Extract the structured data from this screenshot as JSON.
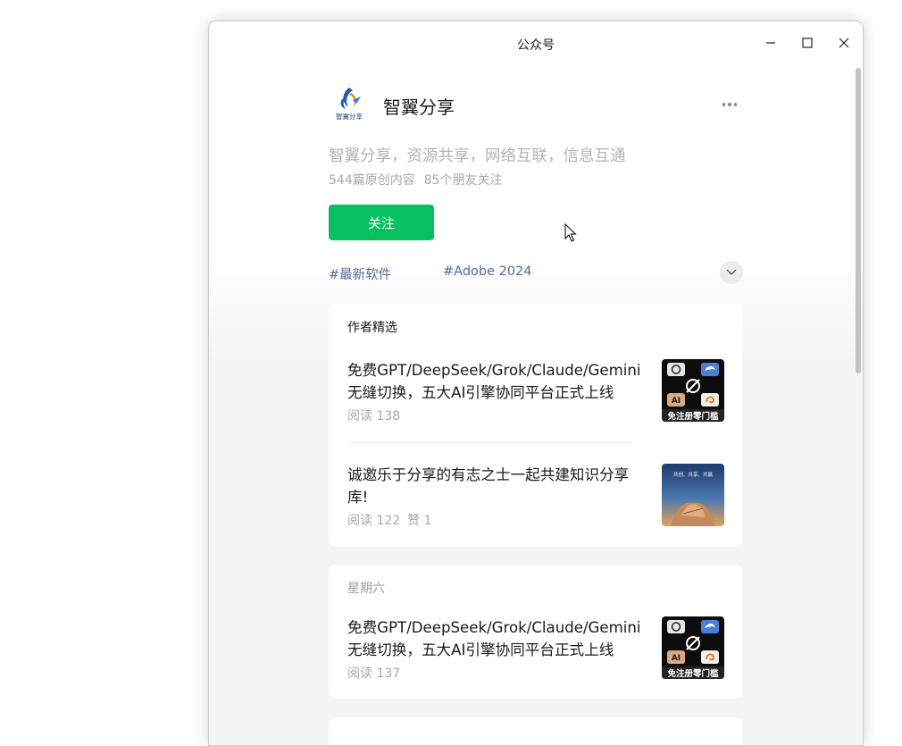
{
  "window": {
    "title": "公众号",
    "minimize_icon": "minimize-icon",
    "maximize_icon": "maximize-icon",
    "close_icon": "close-icon"
  },
  "account": {
    "avatar_text": "智翼分享",
    "name": "智翼分享",
    "description": "智翼分享，资源共享，网络互联，信息互通",
    "original_count": "544篇原创内容",
    "friends_following": "85个朋友关注",
    "follow_label": "关注",
    "tags": [
      "#最新软件",
      "#Adobe 2024"
    ],
    "more_icon": "more-dots-icon",
    "expand_icon": "chevron-down-icon"
  },
  "featured": {
    "header": "作者精选",
    "articles": [
      {
        "title": "免费GPT/DeepSeek/Grok/Claude/Gemini无缝切换，五大AI引擎协同平台正式上线",
        "reads": "阅读 138",
        "likes": "",
        "thumb_text": "免注册零门槛"
      },
      {
        "title": "诚邀乐于分享的有志之士一起共建知识分享库!",
        "reads": "阅读 122",
        "likes": "赞 1",
        "thumb_text": "共创、共享、共赢"
      }
    ]
  },
  "saturday": {
    "header": "星期六",
    "articles": [
      {
        "title": "免费GPT/DeepSeek/Grok/Claude/Gemini无缝切换，五大AI引擎协同平台正式上线",
        "reads": "阅读 137",
        "thumb_text": "免注册零门槛"
      }
    ]
  },
  "colors": {
    "accent_green": "#07c160",
    "tag_blue": "#576b95",
    "muted_text": "#a8a8a8"
  }
}
